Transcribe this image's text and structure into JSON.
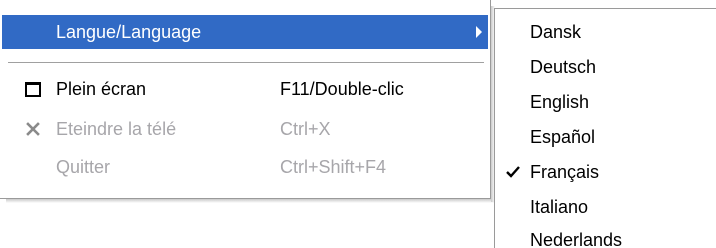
{
  "main_menu": {
    "items": [
      {
        "label": "Langue/Language",
        "shortcut": "",
        "state": "highlighted",
        "has_submenu": true,
        "icon": ""
      },
      {
        "label": "Plein écran",
        "shortcut": "F11/Double-clic",
        "state": "enabled",
        "icon": "fullscreen-window-icon"
      },
      {
        "label": "Eteindre la télé",
        "shortcut": "Ctrl+X",
        "state": "disabled",
        "icon": "close-x-icon"
      },
      {
        "label": "Quitter",
        "shortcut": "Ctrl+Shift+F4",
        "state": "disabled",
        "icon": ""
      }
    ]
  },
  "language_submenu": {
    "items": [
      {
        "label": "Dansk",
        "checked": false
      },
      {
        "label": "Deutsch",
        "checked": false
      },
      {
        "label": "English",
        "checked": false
      },
      {
        "label": "Español",
        "checked": false
      },
      {
        "label": "Français",
        "checked": true
      },
      {
        "label": "Italiano",
        "checked": false
      },
      {
        "label": "Nederlands",
        "checked": false
      }
    ]
  },
  "colors": {
    "highlight": "#316ac5",
    "disabled_text": "#a7a6aa",
    "text": "#000000"
  }
}
